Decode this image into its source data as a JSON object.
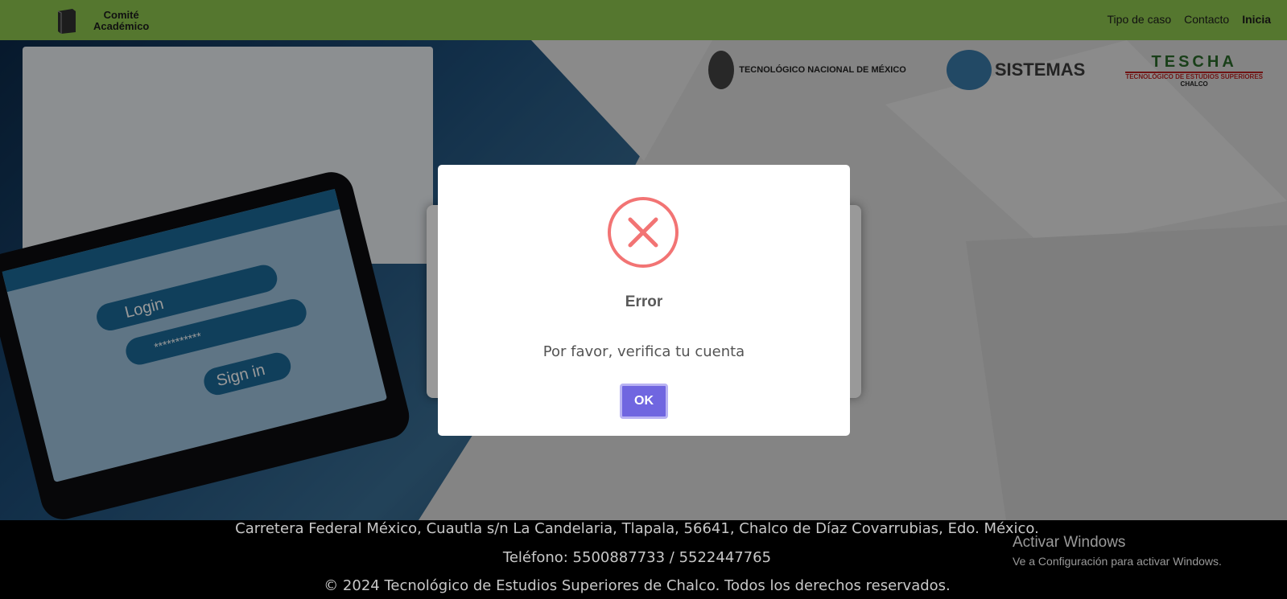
{
  "header": {
    "brand_line1": "Comité",
    "brand_line2": "Académico",
    "nav": [
      "Tipo de caso",
      "Contacto",
      "Inicia"
    ]
  },
  "hero": {
    "login_label": "Login",
    "password_mask": "***********",
    "signin_label": "Sign in",
    "logo_tecnm": "TECNOLÓGICO NACIONAL DE MÉXICO",
    "logo_sistemas": "SISTEMAS",
    "logo_teschs_big": "TESCHA",
    "logo_teschs_small": "TECNOLÓGICO DE ESTUDIOS SUPERIORES",
    "logo_teschs_tiny": "CHALCO"
  },
  "modal": {
    "title": "Error",
    "message": "Por favor, verifica tu cuenta",
    "ok_label": "OK"
  },
  "footer": {
    "address": "Carretera Federal México, Cuautla s/n La Candelaria, Tlapala, 56641, Chalco de Díaz Covarrubias, Edo. México.",
    "phone": "Teléfono: 5500887733 / 5522447765",
    "copyright": "© 2024 Tecnológico de Estudios Superiores de Chalco. Todos los derechos reservados."
  },
  "watermark": {
    "title": "Activar Windows",
    "subtitle": "Ve a Configuración para activar Windows."
  },
  "colors": {
    "header": "#55772f",
    "ok_button": "#7066e0",
    "error_icon": "#f27474"
  }
}
